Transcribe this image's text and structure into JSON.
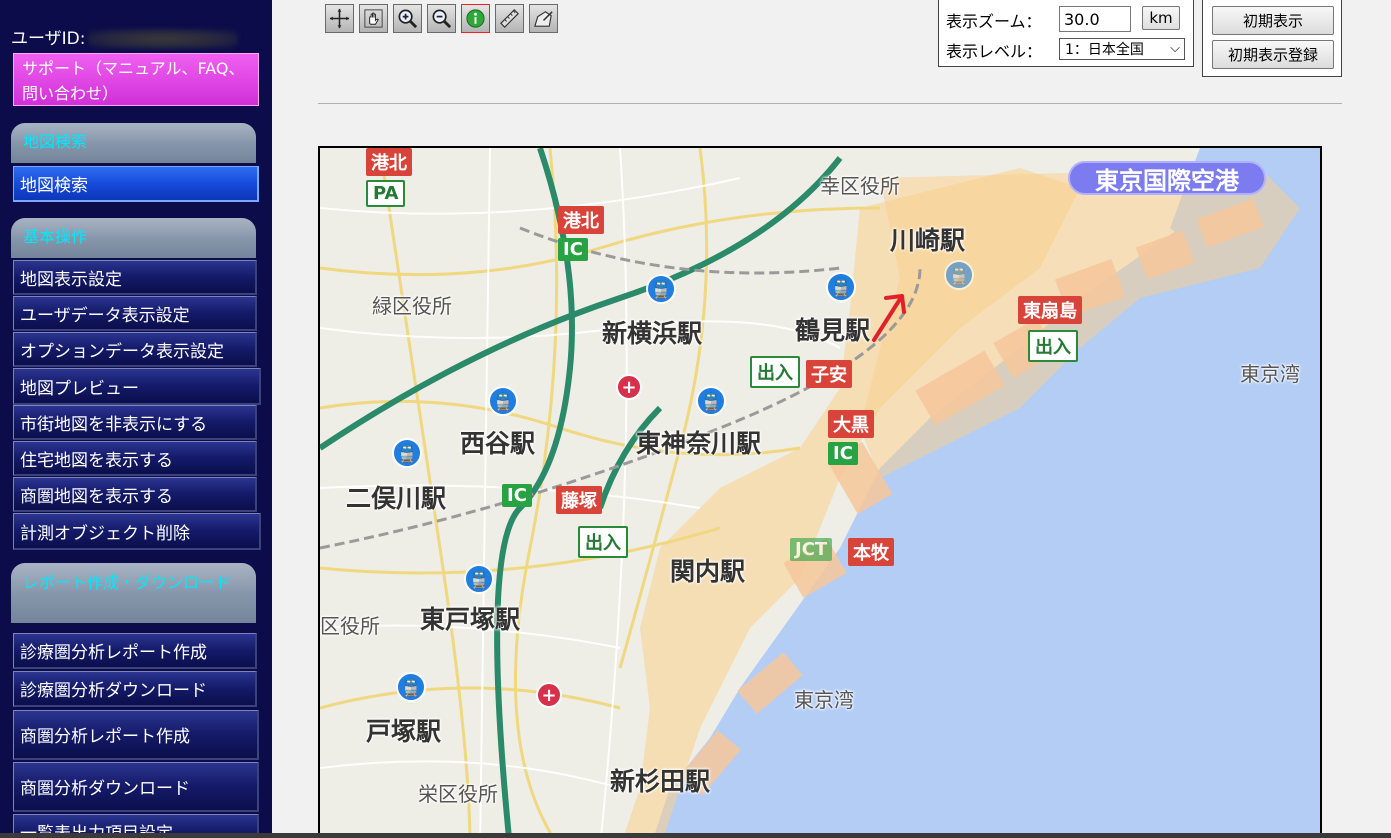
{
  "sidebar": {
    "user_id_label": "ユーザID:",
    "support_label": "サポート（マニュアル、FAQ、問い合わせ）",
    "sections": [
      {
        "title": "地図検索"
      },
      {
        "title": "基本操作"
      },
      {
        "title": "レポート作成・ダウンロード"
      }
    ],
    "search_items": [
      "地図検索"
    ],
    "basic_items": [
      "地図表示設定",
      "ユーザデータ表示設定",
      "オプションデータ表示設定",
      "地図プレビュー",
      "市街地図を非表示にする",
      "住宅地図を表示する",
      "商圏地図を表示する",
      "計測オブジェクト削除"
    ],
    "report_items": [
      "診療圏分析レポート作成",
      "診療圏分析ダウンロード",
      "商圏分析レポート作成",
      "商圏分析ダウンロード",
      "一覧表出力項目設定"
    ]
  },
  "toolbar": {
    "tools": [
      "crosshair-icon",
      "pan-hand-icon",
      "zoom-in-icon",
      "zoom-out-icon",
      "info-icon",
      "ruler-icon",
      "area-measure-icon"
    ],
    "selected": "info-icon"
  },
  "zoom": {
    "zoom_label": "表示ズーム：",
    "zoom_value": "30.0",
    "unit_button": "km",
    "level_label": "表示レベル：",
    "level_value": "1：日本全国"
  },
  "init": {
    "reset_button": "初期表示",
    "register_button": "初期表示登録"
  },
  "map": {
    "airport": "東京国際空港",
    "stations": [
      "新横浜駅",
      "鶴見駅",
      "川崎駅",
      "東神奈川駅",
      "西谷駅",
      "二俣川駅",
      "関内駅",
      "東戸塚駅",
      "戸塚駅",
      "新杉田駅"
    ],
    "offices": [
      "緑区役所",
      "栄区役所",
      "区役所"
    ],
    "places": [
      "幸区役所",
      "東京湾",
      "東京湾"
    ],
    "badges": {
      "kohoku_1": "港北",
      "pa": "PA",
      "kohoku_2": "港北",
      "ic_1": "IC",
      "higashi_ogishima": "東扇島",
      "exit_1": "出入",
      "exit_2": "出入",
      "daikoku": "大黒",
      "fujisawa": "藤塚",
      "ic_2": "IC",
      "exit_3": "出入",
      "jct": "JCT",
      "honmoku": "本牧",
      "koyasu": "子安"
    },
    "colors": {
      "sea": "#b4cdf5",
      "land": "#eeede6",
      "highlight": "#fbd08a",
      "highway": "#2a8a6a"
    }
  }
}
